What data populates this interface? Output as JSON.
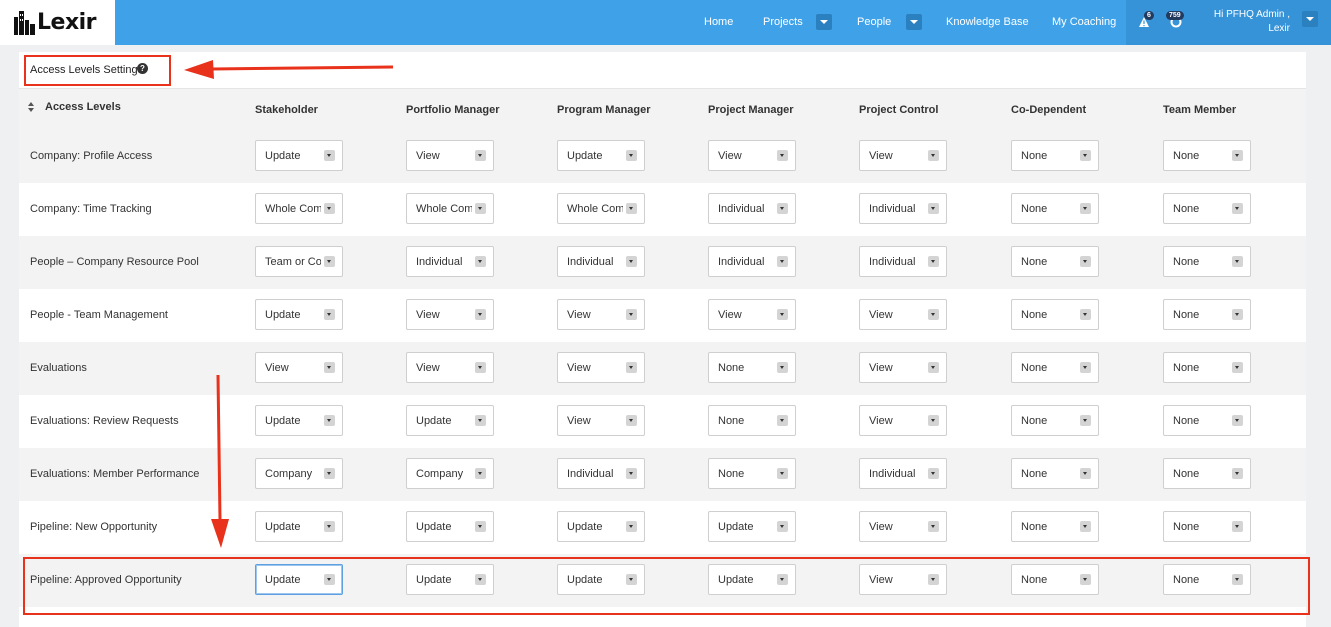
{
  "brand": {
    "name": "Lexir"
  },
  "nav": {
    "items": [
      {
        "label": "Home"
      },
      {
        "label": "Projects"
      },
      {
        "label": "People"
      },
      {
        "label": "Knowledge Base"
      },
      {
        "label": "My Coaching"
      }
    ],
    "alerts_count": "6",
    "notifications_count": "759",
    "user_greeting_line1": "Hi PFHQ Admin ,",
    "user_greeting_line2": "Lexir"
  },
  "panel": {
    "title": "Access Levels Settings"
  },
  "table": {
    "first_header": "Access Levels",
    "columns": [
      "Stakeholder",
      "Portfolio Manager",
      "Program Manager",
      "Project Manager",
      "Project Control",
      "Co-Dependent",
      "Team Member"
    ],
    "rows": [
      {
        "label": "Company: Profile Access",
        "values": [
          "Update",
          "View",
          "Update",
          "View",
          "View",
          "None",
          "None"
        ]
      },
      {
        "label": "Company: Time Tracking",
        "values": [
          "Whole Company",
          "Whole Company",
          "Whole Company",
          "Individual",
          "Individual",
          "None",
          "None"
        ]
      },
      {
        "label": "People – Company Resource Pool",
        "values": [
          "Team or Company",
          "Individual",
          "Individual",
          "Individual",
          "Individual",
          "None",
          "None"
        ]
      },
      {
        "label": "People - Team Management",
        "values": [
          "Update",
          "View",
          "View",
          "View",
          "View",
          "None",
          "None"
        ]
      },
      {
        "label": "Evaluations",
        "values": [
          "View",
          "View",
          "View",
          "None",
          "View",
          "None",
          "None"
        ]
      },
      {
        "label": "Evaluations: Review Requests",
        "values": [
          "Update",
          "Update",
          "View",
          "None",
          "View",
          "None",
          "None"
        ]
      },
      {
        "label": "Evaluations: Member Performance",
        "values": [
          "Company",
          "Company",
          "Individual",
          "None",
          "Individual",
          "None",
          "None"
        ]
      },
      {
        "label": "Pipeline: New Opportunity",
        "values": [
          "Update",
          "Update",
          "Update",
          "Update",
          "View",
          "None",
          "None"
        ]
      },
      {
        "label": "Pipeline: Approved Opportunity",
        "values": [
          "Update",
          "Update",
          "Update",
          "Update",
          "View",
          "None",
          "None"
        ]
      }
    ]
  },
  "annotation_color": "#e8321c"
}
